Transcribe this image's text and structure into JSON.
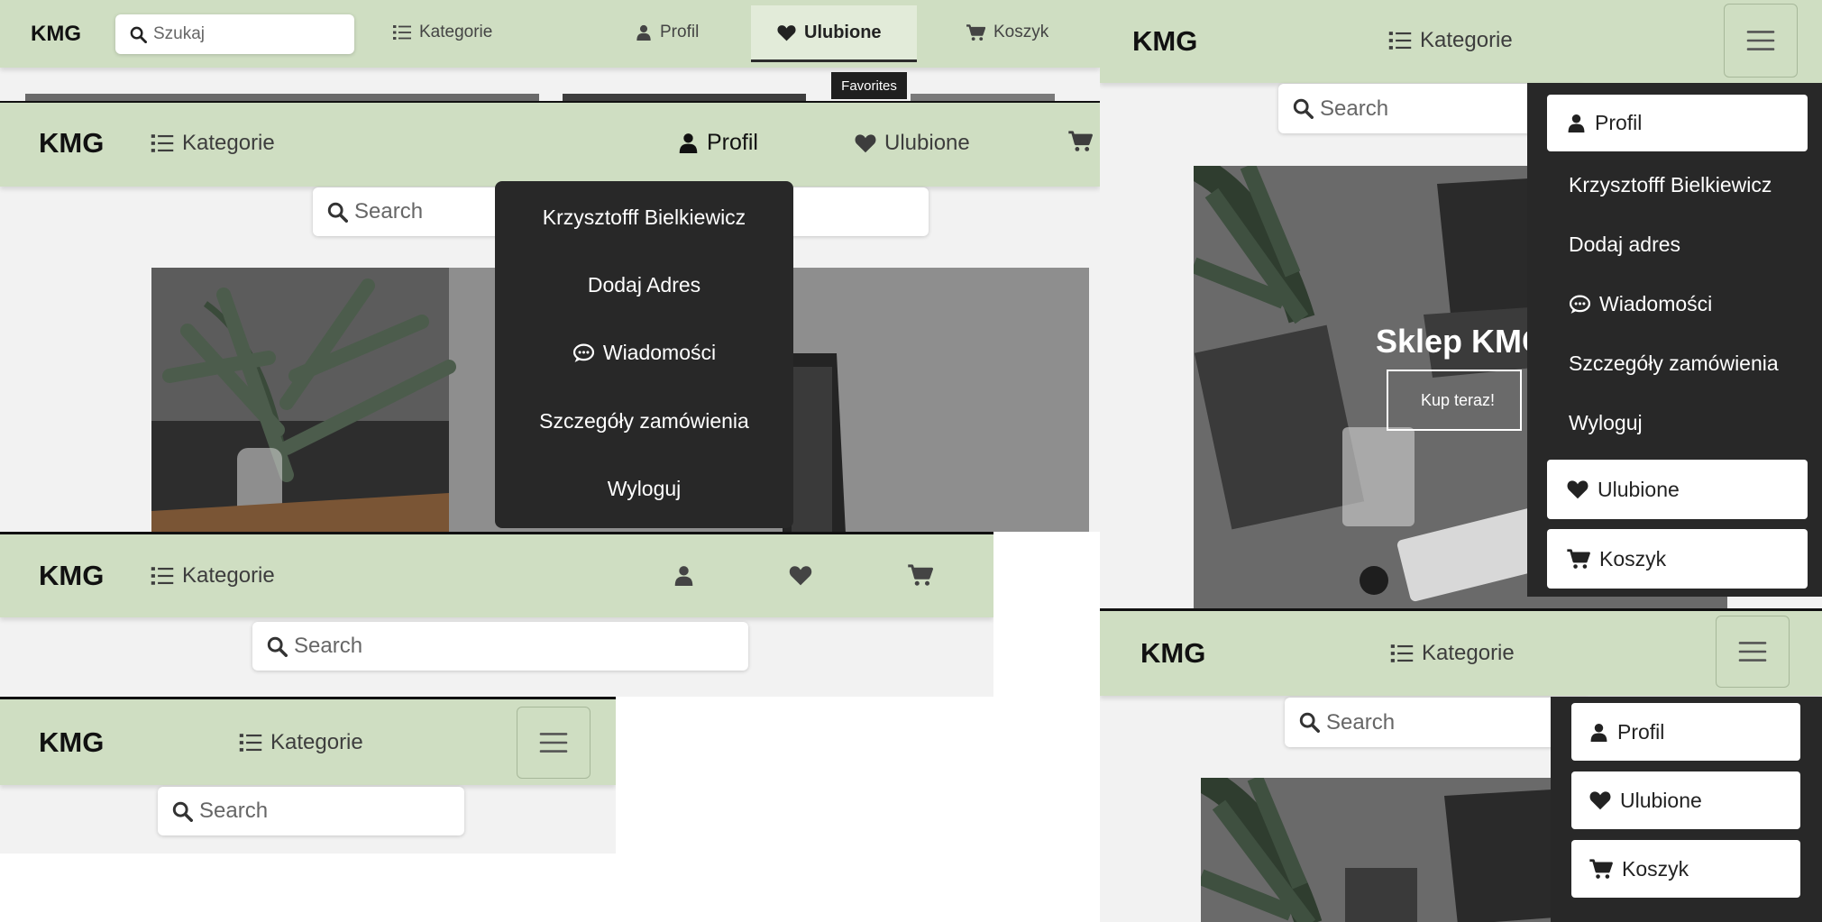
{
  "brand": "KMG",
  "p1": {
    "search_placeholder": "Szukaj",
    "categories": "Kategorie",
    "profile": "Profil",
    "favorites": "Ulubione",
    "cart": "Koszyk",
    "tooltip": "Favorites"
  },
  "p2": {
    "categories": "Kategorie",
    "profile": "Profil",
    "favorites": "Ulubione",
    "search_placeholder": "Search",
    "menu": {
      "user": "Krzysztofff Bielkiewicz",
      "address": "Dodaj Adres",
      "messages": "Wiadomości",
      "orders": "Szczegóły zamówienia",
      "logout": "Wyloguj"
    }
  },
  "p3": {
    "categories": "Kategorie",
    "search_placeholder": "Search"
  },
  "p4": {
    "categories": "Kategorie",
    "search_placeholder": "Search"
  },
  "p5": {
    "categories": "Kategorie",
    "search_placeholder": "Search",
    "hero_title": "Sklep KMG",
    "hero_button": "Kup teraz!",
    "profile": "Profil",
    "menu": {
      "user": "Krzysztofff Bielkiewicz",
      "address": "Dodaj adres",
      "messages": "Wiadomości",
      "orders": "Szczegóły zamówienia",
      "logout": "Wyloguj"
    },
    "favorites": "Ulubione",
    "cart": "Koszyk"
  },
  "p6": {
    "categories": "Kategorie",
    "search_placeholder": "Search",
    "profile": "Profil",
    "favorites": "Ulubione",
    "cart": "Koszyk"
  },
  "colors": {
    "navbar": "#cfdec2",
    "dropdown": "#282828",
    "active_tab": "#e2ebd9",
    "page": "#f2f2f2"
  }
}
